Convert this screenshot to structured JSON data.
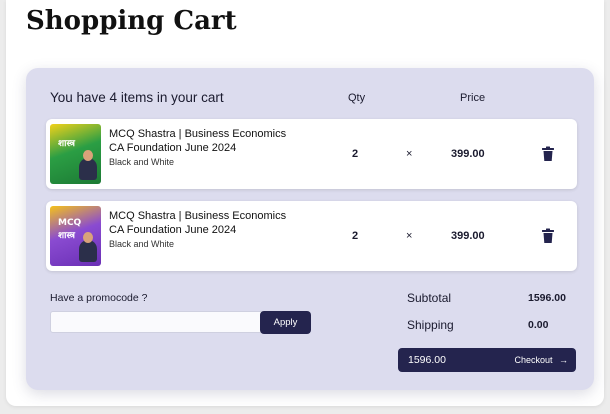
{
  "page": {
    "title": "Shopping Cart"
  },
  "cart": {
    "count_text": "You have 4 items in your cart",
    "qty_header": "Qty",
    "price_header": "Price",
    "items": [
      {
        "name_line1": "MCQ Shastra | Business Economics",
        "name_line2": "CA Foundation June 2024",
        "variant": "Black and White",
        "qty": "2",
        "multiply": "×",
        "price": "399.00",
        "thumb_text": "शास्त्र",
        "thumb_color": "#2b9e44"
      },
      {
        "name_line1": "MCQ Shastra | Business Economics",
        "name_line2": "CA Foundation June 2024",
        "variant": "Black and White",
        "qty": "2",
        "multiply": "×",
        "price": "399.00",
        "thumb_text": "MCQ शास्त्र",
        "thumb_color": "#8a4bd1"
      }
    ]
  },
  "promo": {
    "label": "Have a promocode ?",
    "input_value": "",
    "input_placeholder": "",
    "apply_label": "Apply"
  },
  "summary": {
    "subtotal_label": "Subtotal",
    "subtotal_value": "1596.00",
    "shipping_label": "Shipping",
    "shipping_value": "0.00",
    "total_value": "1596.00",
    "checkout_label": "Checkout",
    "checkout_icon": "arrow-right-icon"
  },
  "colors": {
    "panel_bg": "#dcdcee",
    "accent_dark": "#24244e"
  }
}
